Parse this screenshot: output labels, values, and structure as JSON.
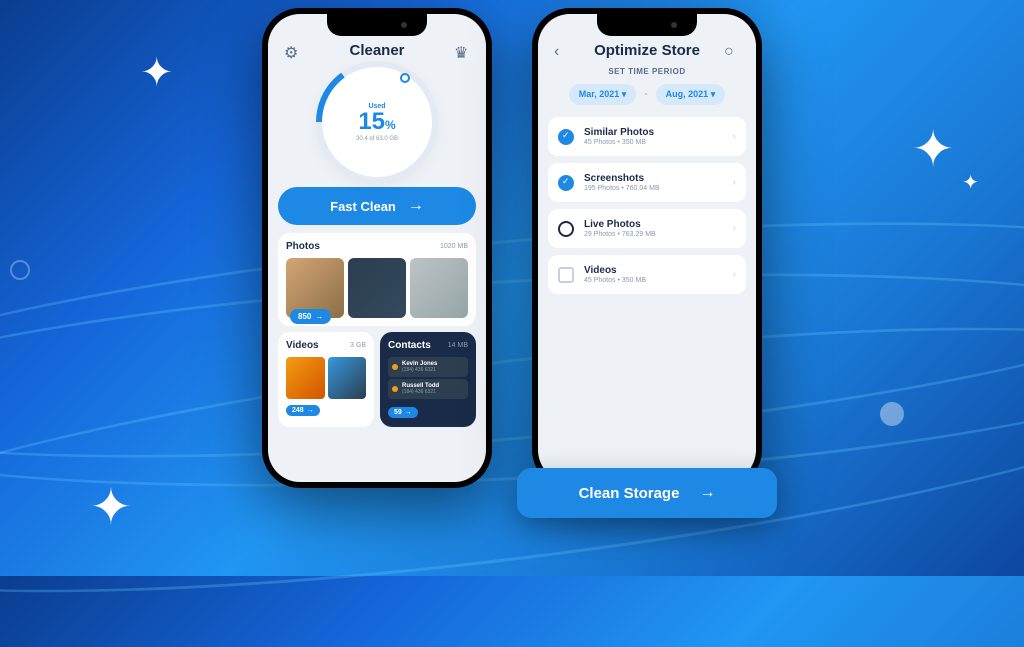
{
  "phone1": {
    "title": "Cleaner",
    "gauge": {
      "label": "Used",
      "value": "15",
      "unit": "%",
      "sub": "30.4 of 63.0 GB"
    },
    "fast_clean": "Fast Clean",
    "photos": {
      "title": "Photos",
      "size": "1020 MB",
      "badge": "850"
    },
    "videos": {
      "title": "Videos",
      "size": "3 GB",
      "badge": "248"
    },
    "contacts": {
      "title": "Contacts",
      "size": "14 MB",
      "badge": "59",
      "items": [
        {
          "name": "Kevin Jones",
          "sub": "(184) 436 6321"
        },
        {
          "name": "Russell Todd",
          "sub": "(184) 436 6321"
        }
      ]
    }
  },
  "phone2": {
    "title": "Optimize Store",
    "section": "SET TIME PERIOD",
    "date_from": "Mar, 2021 ▾",
    "date_to": "Aug, 2021 ▾",
    "options": [
      {
        "title": "Similar Photos",
        "meta": "45 Photos  •  350 MB",
        "checked": true,
        "round": true
      },
      {
        "title": "Screenshots",
        "meta": "195 Photos  •  760.04 MB",
        "checked": true,
        "round": true
      },
      {
        "title": "Live Photos",
        "meta": "29 Photos  •  763.29 MB",
        "checked": false,
        "round": true
      },
      {
        "title": "Videos",
        "meta": "45 Photos  •  350 MB",
        "checked": false,
        "round": false
      }
    ],
    "clean_btn": "Clean Storage"
  }
}
